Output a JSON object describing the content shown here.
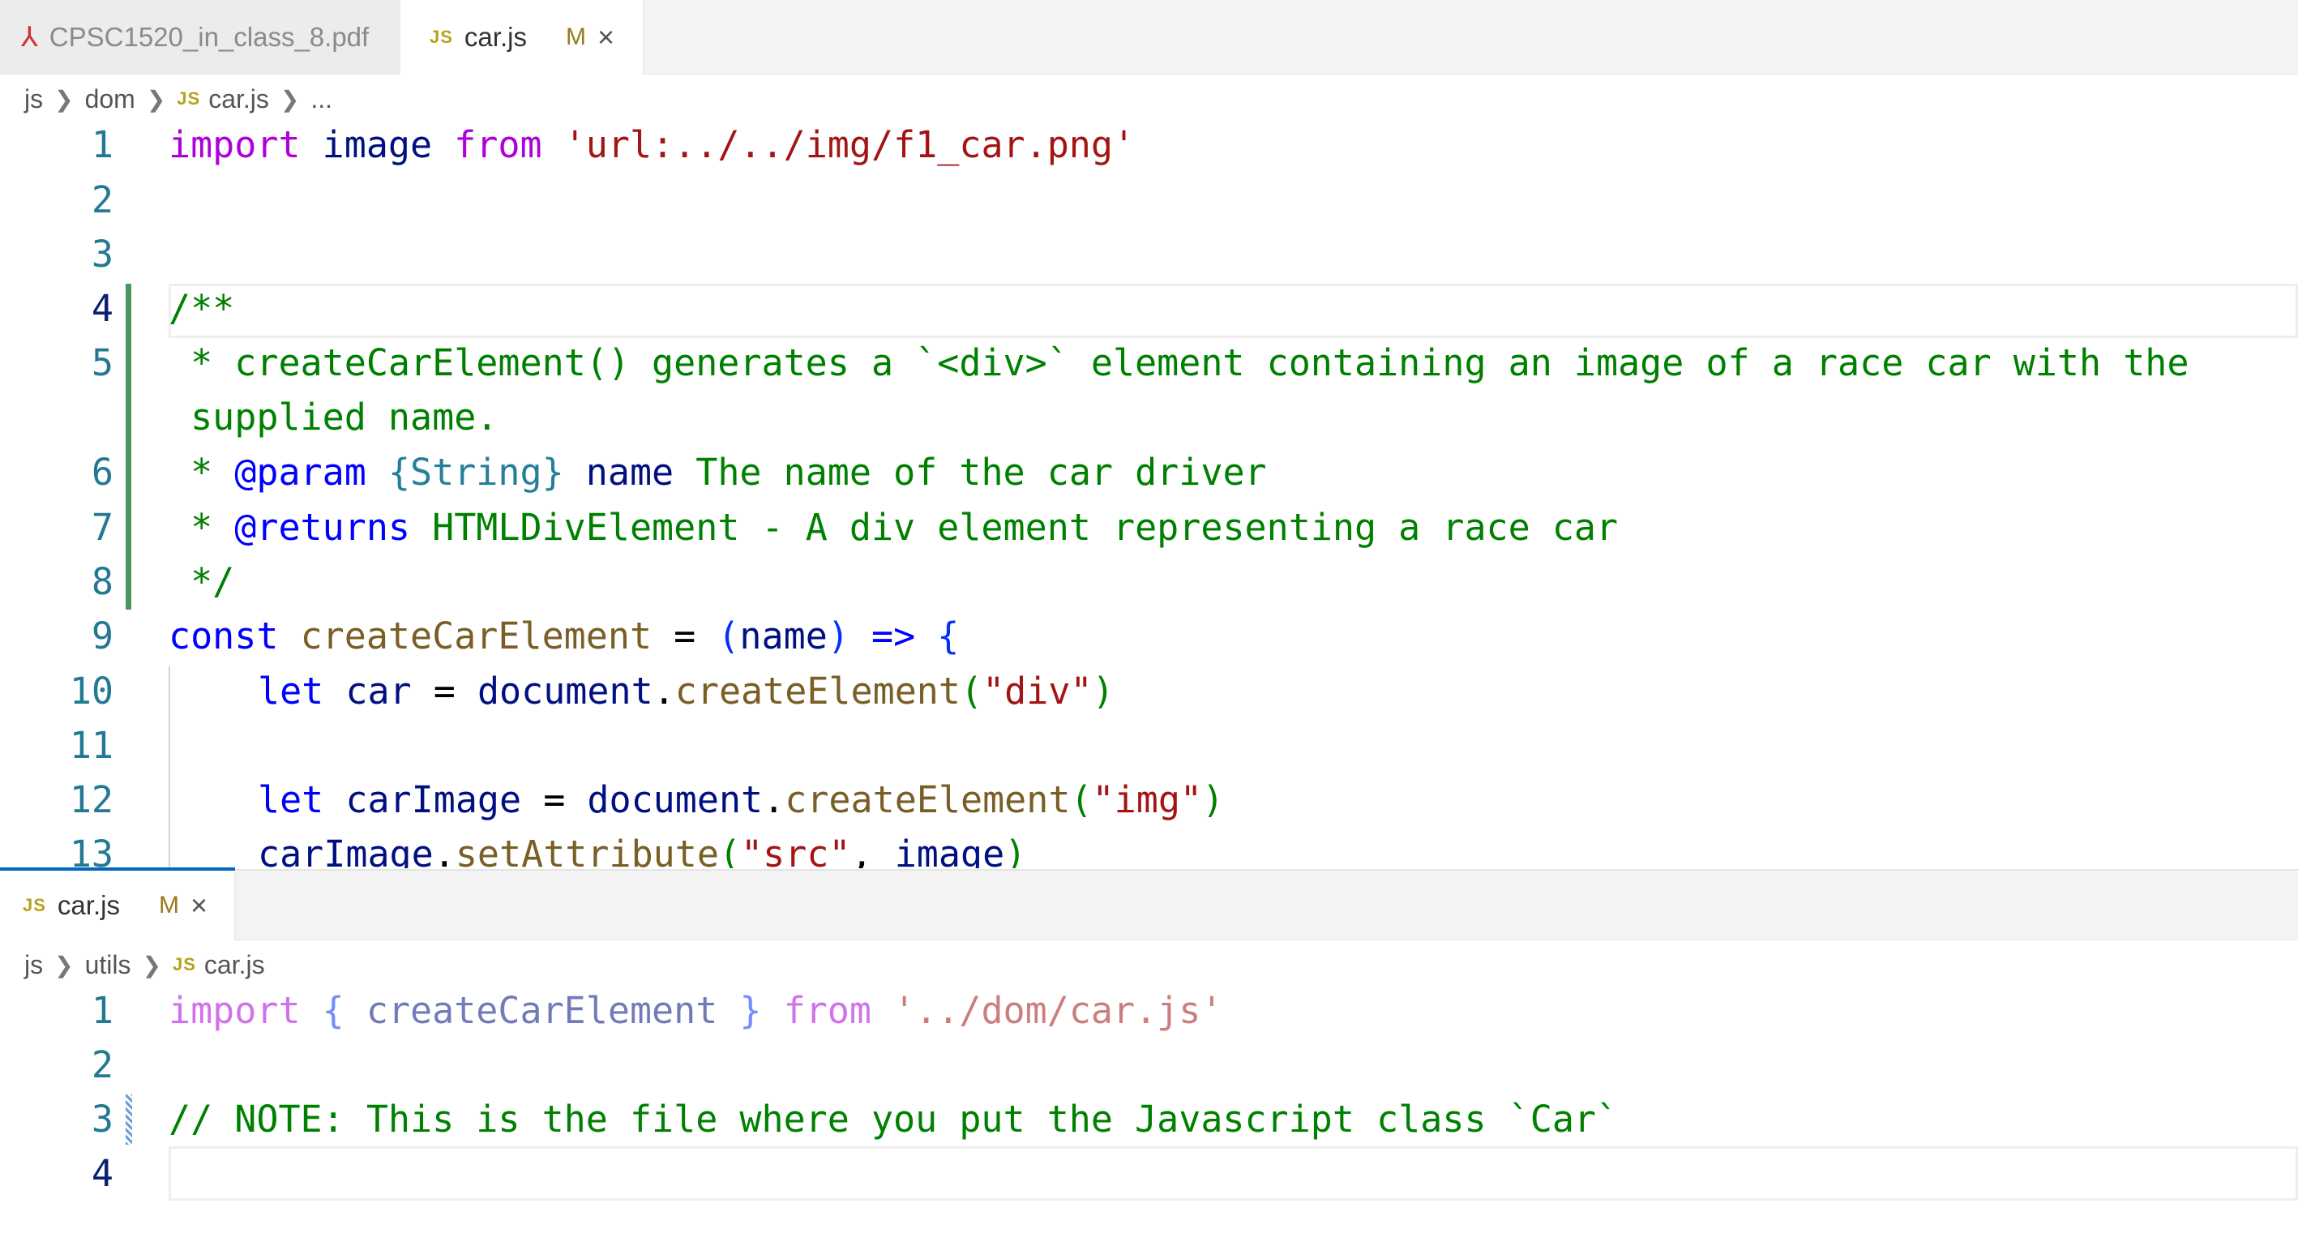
{
  "top_tabs": [
    {
      "label": "CPSC1520_in_class_8.pdf",
      "icon": "pdf-icon"
    },
    {
      "label": "car.js",
      "badge": "JS",
      "modified": "M",
      "close": "×"
    }
  ],
  "top_breadcrumb": {
    "parts": [
      "js",
      "dom"
    ],
    "file": "car.js",
    "badge": "JS",
    "more": "..."
  },
  "top_code": {
    "line_numbers": [
      "1",
      "2",
      "3",
      "4",
      "5",
      "",
      "6",
      "7",
      "8",
      "9",
      "10",
      "11",
      "12",
      "13"
    ],
    "l1": {
      "kw": "import",
      "name": "image",
      "from": "from",
      "str": "'url:../../img/f1_car.png'"
    },
    "l4": "/**",
    "l5a": " * createCarElement() generates a `<div>` element containing an image of a race car with the",
    "l5b": " supplied name.",
    "l6": {
      "star": " * ",
      "tag": "@param",
      "type": "{String}",
      "name": "name",
      "desc": " The name of the car driver"
    },
    "l7": {
      "star": " * ",
      "tag": "@returns",
      "desc": " HTMLDivElement - A div element representing a race car"
    },
    "l8": " */",
    "l9": {
      "kw": "const",
      "fn": "createCarElement",
      "eq": " = ",
      "open": "(",
      "param": "name",
      "close": ")",
      "arrow": " => ",
      "brace": "{"
    },
    "l10": {
      "kw": "let",
      "var": "car",
      "eq": " = ",
      "obj": "document",
      "dot": ".",
      "fn": "createElement",
      "open": "(",
      "str": "\"div\"",
      "close": ")"
    },
    "l12": {
      "kw": "let",
      "var": "carImage",
      "eq": " = ",
      "obj": "document",
      "dot": ".",
      "fn": "createElement",
      "open": "(",
      "str": "\"img\"",
      "close": ")"
    },
    "l13": {
      "var": "carImage",
      "dot": ".",
      "fn": "setAttribute",
      "open": "(",
      "str": "\"src\"",
      "comma": ", ",
      "arg": "image",
      "close": ")"
    }
  },
  "bottom_tab": {
    "label": "car.js",
    "badge": "JS",
    "modified": "M",
    "close": "×"
  },
  "bottom_breadcrumb": {
    "parts": [
      "js",
      "utils"
    ],
    "file": "car.js",
    "badge": "JS"
  },
  "bottom_code": {
    "line_numbers": [
      "1",
      "2",
      "3",
      "4"
    ],
    "l1": {
      "kw": "import",
      "open": "{",
      "name": "createCarElement",
      "close": "}",
      "from": "from",
      "str": "'../dom/car.js'"
    },
    "l3": "// NOTE: This is the file where you put the Javascript class `Car`"
  },
  "colors": {
    "keyword_purple": "#af00db",
    "keyword_blue": "#0000ff",
    "string": "#a31515",
    "comment": "#008000",
    "line_number": "#237893",
    "change_bar": "#48985d"
  }
}
